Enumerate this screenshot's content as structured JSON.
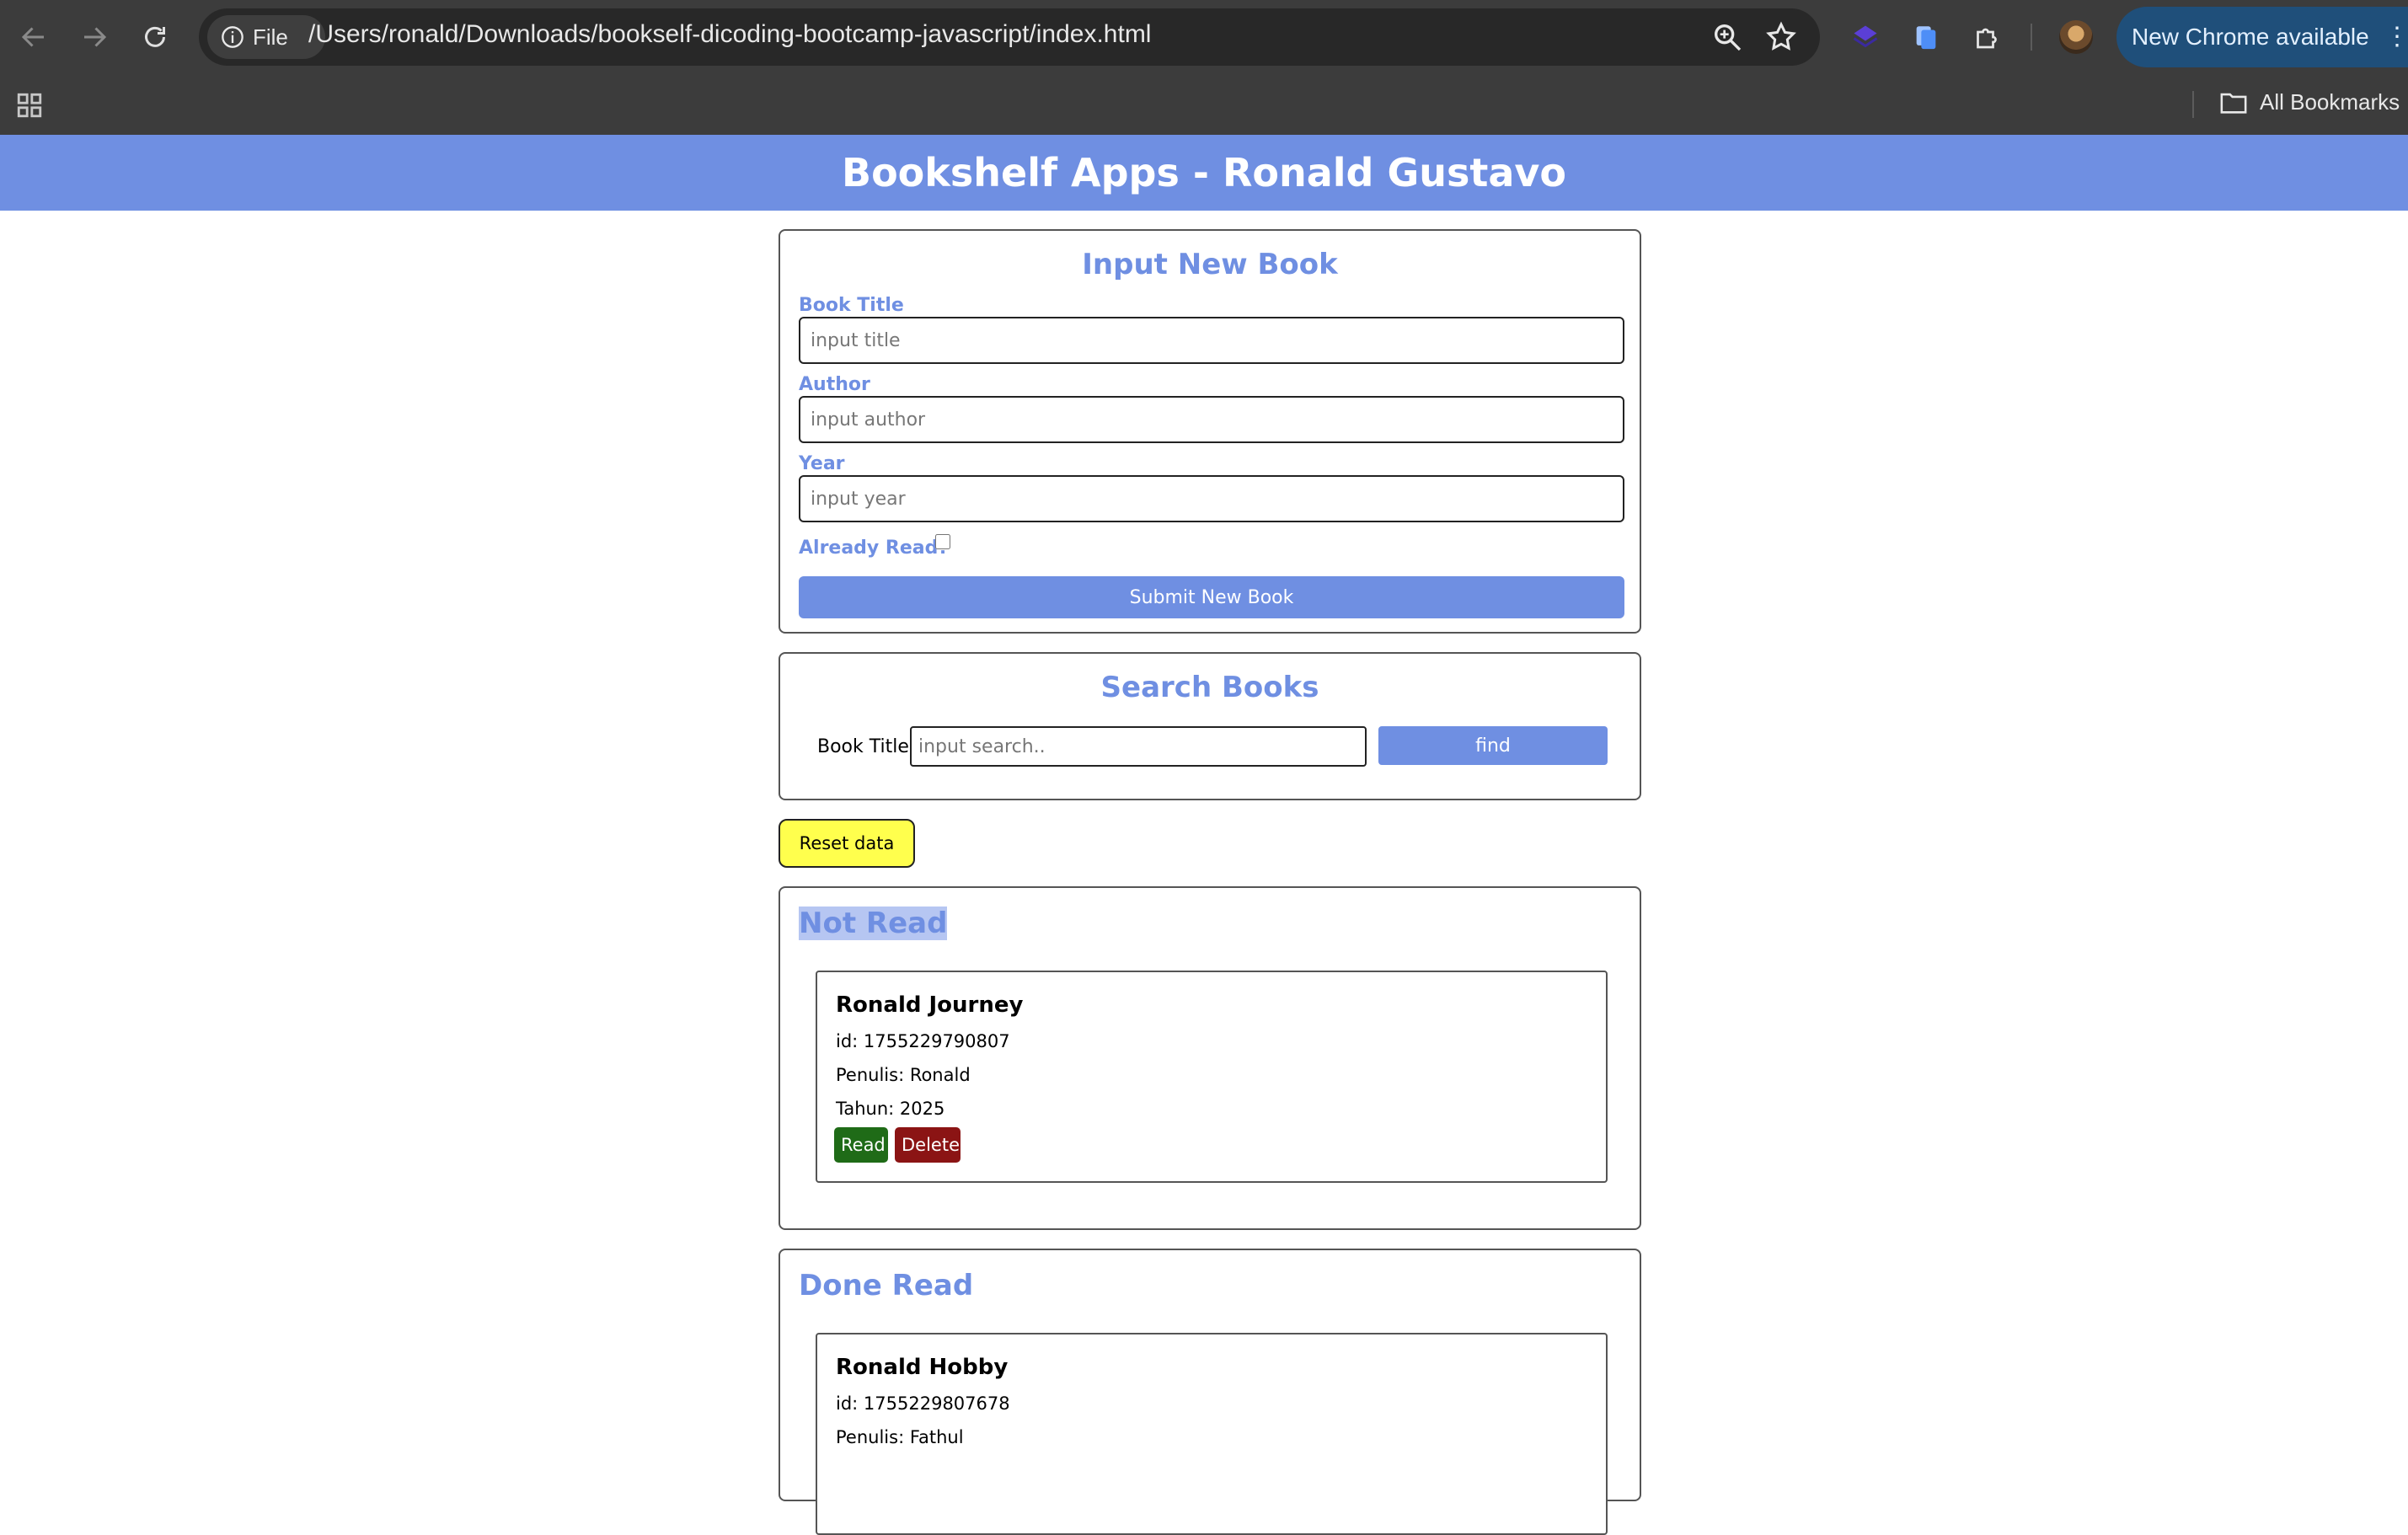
{
  "browser": {
    "site_chip_label": "File",
    "url": "/Users/ronald/Downloads/bookself-dicoding-bootcamp-javascript/index.html",
    "update_label": "New Chrome available",
    "bookmarks_label": "All Bookmarks"
  },
  "app": {
    "header_title": "Bookshelf Apps - Ronald Gustavo"
  },
  "input_form": {
    "title": "Input New Book",
    "title_label": "Book Title",
    "title_placeholder": "input title",
    "author_label": "Author",
    "author_placeholder": "input author",
    "year_label": "Year",
    "year_placeholder": "input year",
    "already_read_label": "Already Read?",
    "already_read_checked": false,
    "submit_label": "Submit New Book"
  },
  "search": {
    "title": "Search Books",
    "label": "Book Title",
    "placeholder": "input search..",
    "button_label": "find"
  },
  "reset_label": "Reset data",
  "shelves": {
    "not_read": {
      "title": "Not Read",
      "books": [
        {
          "title": "Ronald Journey",
          "id": "id: 1755229790807",
          "author": "Penulis: Ronald",
          "year": "Tahun: 2025",
          "read_label": "Read",
          "delete_label": "Delete"
        }
      ]
    },
    "done_read": {
      "title": "Done Read",
      "books": [
        {
          "title": "Ronald Hobby",
          "id": "id: 1755229807678",
          "author": "Penulis: Fathul"
        }
      ]
    }
  },
  "colors": {
    "accent": "#6f8fe2",
    "read_button": "#1f6b17",
    "delete_button": "#8b1414",
    "reset_button": "#ffff4d"
  }
}
